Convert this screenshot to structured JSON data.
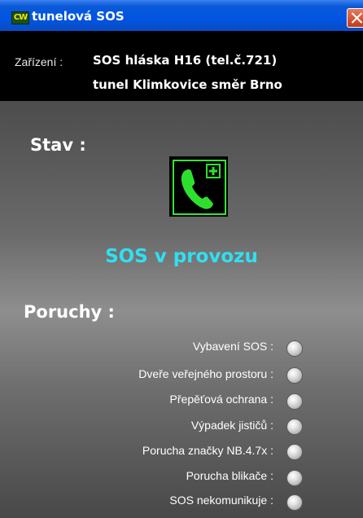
{
  "window": {
    "title": "tunelová SOS",
    "app_icon_text": "CW"
  },
  "device": {
    "label": "Zařízení :",
    "name_line1": "SOS hláska H16 (tel.č.721)",
    "name_line2": "tunel Klimkovice směr Brno"
  },
  "status": {
    "heading": "Stav :",
    "value": "SOS v provozu",
    "icon": "phone-plus-icon",
    "color": "#2fe0f2"
  },
  "faults": {
    "heading": "Poruchy :",
    "items": [
      {
        "label": "Vybavení SOS :",
        "indicator": "off"
      },
      {
        "label": "Dveře veřejného prostoru :",
        "indicator": "off"
      },
      {
        "label": "Přepěťová ochrana :",
        "indicator": "off"
      },
      {
        "label": "Výpadek jističů :",
        "indicator": "off"
      },
      {
        "label": "Porucha značky NB.4.7x :",
        "indicator": "off"
      },
      {
        "label": "Porucha blikače :",
        "indicator": "off"
      },
      {
        "label": "SOS nekomunikuje :",
        "indicator": "off"
      }
    ]
  }
}
